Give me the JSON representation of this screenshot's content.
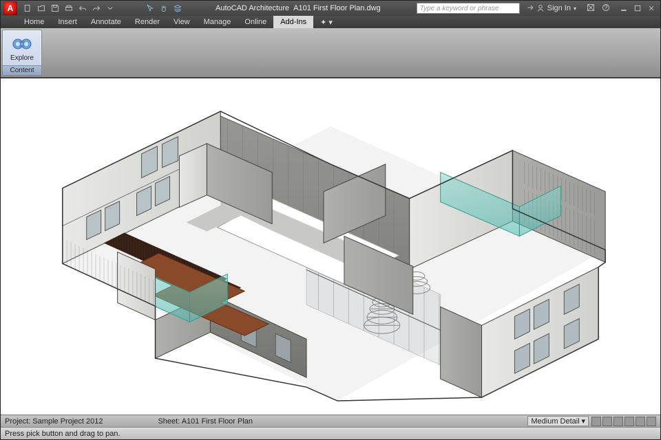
{
  "title": {
    "app": "AutoCAD Architecture",
    "doc": "A101 First Floor Plan.dwg"
  },
  "search": {
    "placeholder": "Type a keyword or phrase"
  },
  "signin": {
    "label": "Sign In"
  },
  "menu": {
    "items": [
      "Home",
      "Insert",
      "Annotate",
      "Render",
      "View",
      "Manage",
      "Online",
      "Add-Ins"
    ],
    "active": 7
  },
  "ribbon": {
    "explore_label": "Explore",
    "group_label": "Content"
  },
  "status": {
    "project": "Project: Sample Project 2012",
    "sheet": "Sheet: A101 First Floor Plan",
    "detail": "Medium Detail",
    "hint": "Press pick button and drag to pan."
  },
  "appmenu_letter": "A"
}
